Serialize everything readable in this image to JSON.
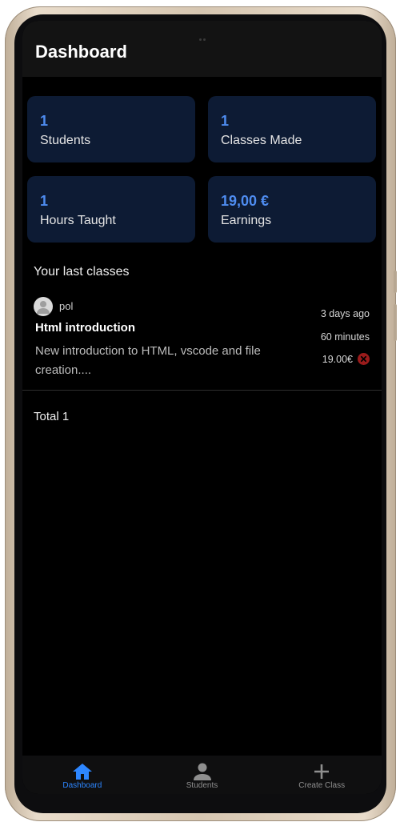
{
  "appbar": {
    "title": "Dashboard"
  },
  "stats": [
    {
      "value": "1",
      "label": "Students"
    },
    {
      "value": "1",
      "label": "Classes Made"
    },
    {
      "value": "1",
      "label": "Hours Taught"
    },
    {
      "value": "19,00 €",
      "label": "Earnings"
    }
  ],
  "section": {
    "title": "Your last classes"
  },
  "classes": [
    {
      "author": "pol",
      "title": "Html introduction",
      "description": "New introduction to HTML, vscode and file creation....",
      "time_ago": "3 days ago",
      "duration": "60 minutes",
      "price": "19.00€"
    }
  ],
  "total": "Total 1",
  "nav": [
    {
      "label": "Dashboard",
      "icon": "home-icon",
      "active": true
    },
    {
      "label": "Students",
      "icon": "person-icon",
      "active": false
    },
    {
      "label": "Create Class",
      "icon": "plus-icon",
      "active": false
    }
  ],
  "colors": {
    "accent": "#2d86ff",
    "card_bg": "#0d1b34",
    "stat_value": "#4e8cf0",
    "cancel": "#9a1b1b"
  }
}
